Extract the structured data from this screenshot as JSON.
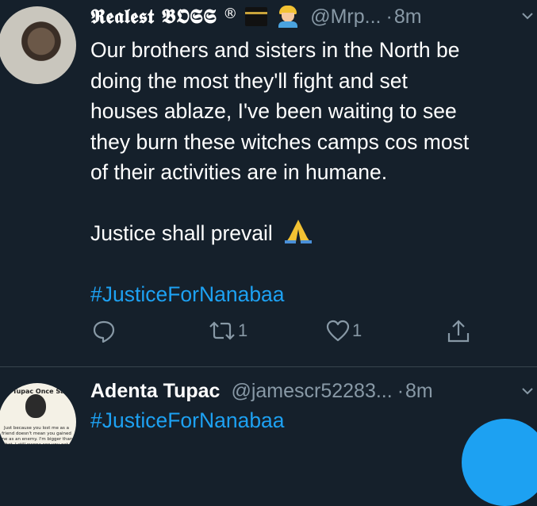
{
  "tweets": [
    {
      "author_name": "𝕽𝖊𝖆𝖑𝖊𝖘𝖙 𝕭𝕺𝕾𝕾",
      "registered": "®",
      "handle": "@Mrp...",
      "dot": "·",
      "time": "8m",
      "text_lines": [
        "Our brothers and sisters in the North be",
        "doing the most they'll fight and set",
        "houses ablaze, I've been waiting to see",
        "they burn these witches camps cos most",
        "of their activities are in humane."
      ],
      "line2": "Justice shall prevail",
      "hashtag": "#JusticeForNanabaa",
      "retweet_count": "1",
      "like_count": "1"
    },
    {
      "author_name": "Adenta Tupac",
      "handle": "@jamescr52283...",
      "dot": "·",
      "time": "8m",
      "hashtag": "#JusticeForNanabaa",
      "avatar_title": "Tupac Once Said",
      "avatar_quote": "Just because you lost me as a friend doesn't mean you gained me as an enemy. I'm bigger than that. I still wanna see you eat."
    }
  ],
  "icons": {
    "reply": "reply-icon",
    "retweet": "retweet-icon",
    "like": "heart-icon",
    "share": "share-icon",
    "menu": "chevron-down-icon"
  },
  "colors": {
    "background": "#15202b",
    "secondary_text": "#8899a6",
    "accent": "#1da1f2",
    "divider": "#38444d"
  }
}
